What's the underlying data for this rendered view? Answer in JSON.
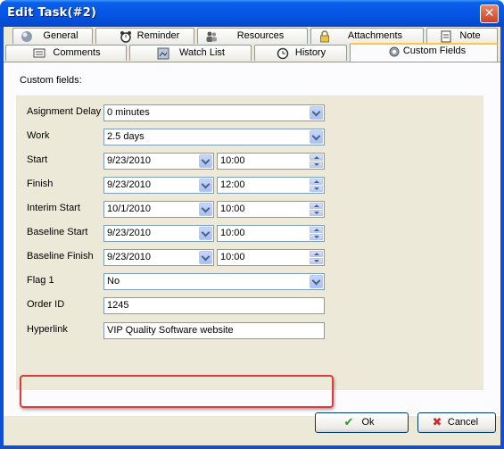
{
  "window": {
    "title": "Edit Task(#2)",
    "close_icon": "close-icon"
  },
  "tabs_top": [
    {
      "label": "General",
      "icon": "general-icon"
    },
    {
      "label": "Reminder",
      "icon": "alarm-clock-icon"
    },
    {
      "label": "Resources",
      "icon": "people-icon"
    },
    {
      "label": "Attachments",
      "icon": "lock-icon"
    },
    {
      "label": "Note",
      "icon": "note-icon"
    }
  ],
  "tabs_bottom": [
    {
      "label": "Comments",
      "icon": "comments-icon"
    },
    {
      "label": "Watch List",
      "icon": "watch-list-icon"
    },
    {
      "label": "History",
      "icon": "history-icon"
    },
    {
      "label": "Custom Fields",
      "icon": "gear-icon",
      "active": true
    }
  ],
  "custom_fields": {
    "heading": "Custom fields:",
    "rows": [
      {
        "label": "Asignment Delay",
        "value": "0 minutes"
      },
      {
        "label": "Work",
        "value": "2.5 days"
      },
      {
        "label": "Start",
        "date": "9/23/2010",
        "time": "10:00"
      },
      {
        "label": "Finish",
        "date": "9/23/2010",
        "time": "12:00"
      },
      {
        "label": "Interim Start",
        "date": "10/1/2010",
        "time": "10:00"
      },
      {
        "label": "Baseline Start",
        "date": "9/23/2010",
        "time": "10:00"
      },
      {
        "label": "Baseline Finish",
        "date": "9/23/2010",
        "time": "10:00"
      },
      {
        "label": "Flag 1",
        "value": "No"
      },
      {
        "label": "Order ID",
        "value": "1245"
      },
      {
        "label": "Hyperlink",
        "value": "VIP Quality Software website"
      }
    ]
  },
  "buttons": {
    "ok": "Ok",
    "cancel": "Cancel"
  },
  "colors": {
    "highlight": "#E03A3A",
    "titlebar": "#0554E2"
  }
}
